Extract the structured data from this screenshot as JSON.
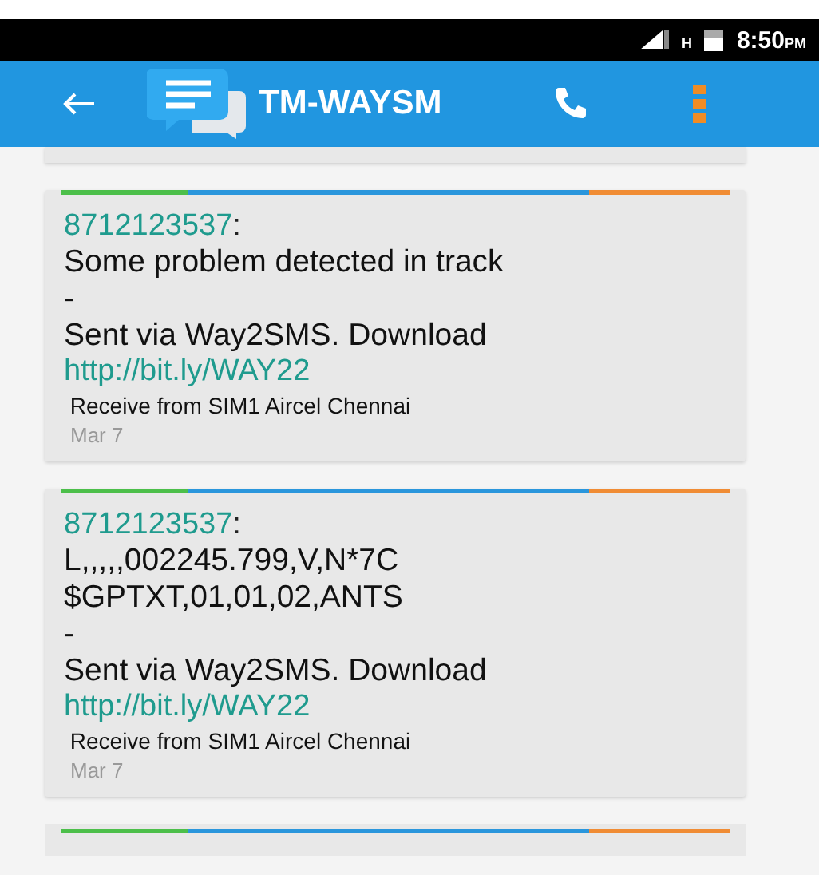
{
  "status_bar": {
    "network": "H",
    "time": "8:50",
    "time_suffix": "PM"
  },
  "app_bar": {
    "title": "TM-WAYSM"
  },
  "messages": [
    {
      "sender": "8712123537",
      "separator": ":",
      "body": "Some problem detected in track\n-\n Sent via Way2SMS. Download",
      "link": "http://bit.ly/WAY22",
      "sim_info": "Receive from SIM1 Aircel Chennai",
      "date": "Mar 7"
    },
    {
      "sender": "8712123537",
      "separator": ":",
      "body": "L,,,,,002245.799,V,N*7C\n$GPTXT,01,01,02,ANTS\n-\n Sent via Way2SMS. Download",
      "link": "http://bit.ly/WAY22",
      "sim_info": "Receive from SIM1 Aircel Chennai",
      "date": "Mar 7"
    }
  ]
}
